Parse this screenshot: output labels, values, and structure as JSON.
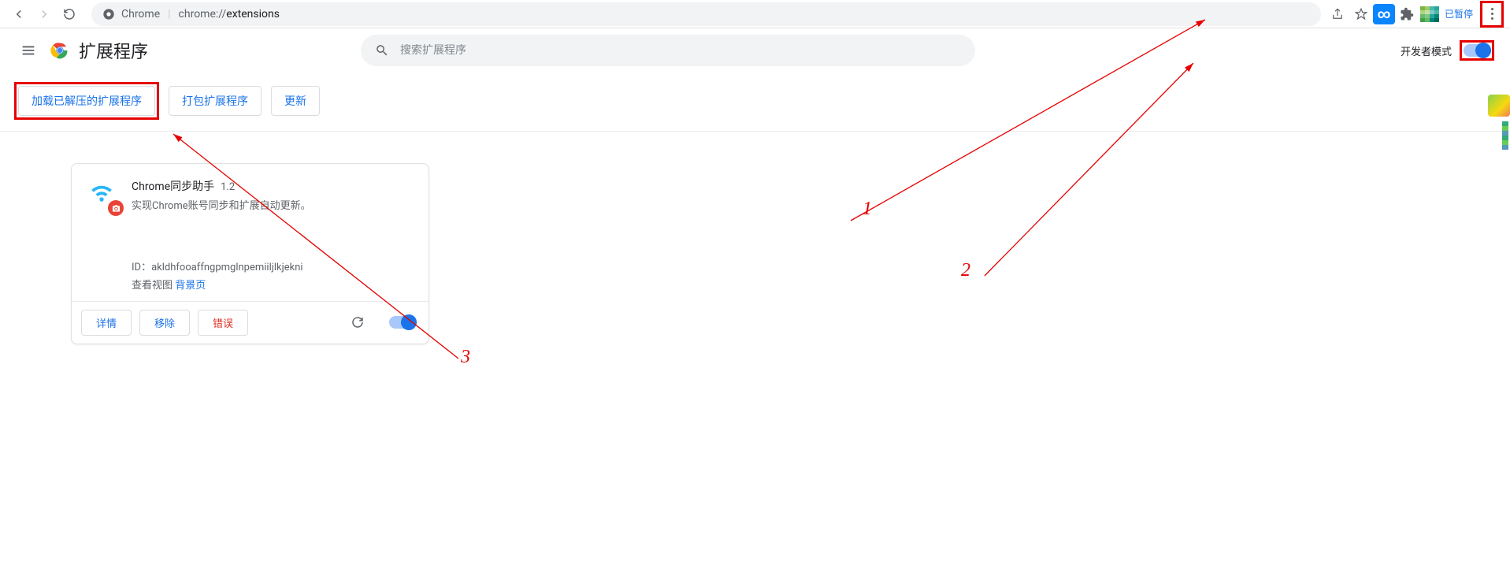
{
  "toolbar": {
    "addr_label": "Chrome",
    "addr_prefix": "chrome://",
    "addr_path": "extensions",
    "paused_label": "已暂停"
  },
  "header": {
    "title": "扩展程序",
    "search_placeholder": "搜索扩展程序",
    "dev_mode_label": "开发者模式"
  },
  "actions": {
    "load_unpacked": "加载已解压的扩展程序",
    "pack_extension": "打包扩展程序",
    "update": "更新"
  },
  "card": {
    "name": "Chrome同步助手",
    "version": "1.2",
    "description": "实现Chrome账号同步和扩展自动更新。",
    "id_label": "ID：",
    "id_value": "akldhfooaffngpmglnpemiiljlkjekni",
    "views_label": "查看视图",
    "views_link": "背景页",
    "btn_details": "详情",
    "btn_remove": "移除",
    "btn_errors": "错误"
  },
  "annotations": {
    "one": "1",
    "two": "2",
    "three": "3"
  }
}
